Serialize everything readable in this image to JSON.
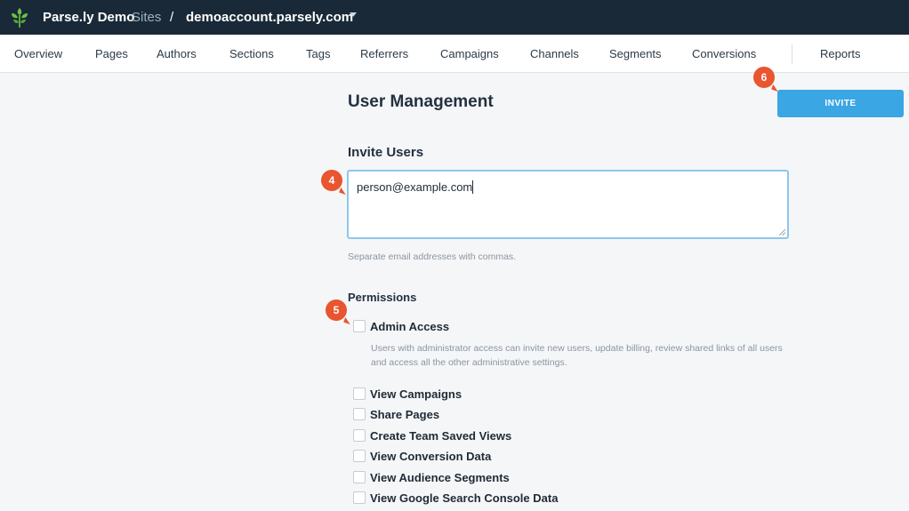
{
  "topbar": {
    "brand": "Parse.ly Demo",
    "sites_label": "Sites",
    "separator": "/",
    "domain": "demoaccount.parsely.com",
    "logo_icon": "parsely-leaf-icon",
    "brand_color": "#192938"
  },
  "nav": {
    "items": [
      {
        "label": "Overview"
      },
      {
        "label": "Pages"
      },
      {
        "label": "Authors"
      },
      {
        "label": "Sections"
      },
      {
        "label": "Tags"
      },
      {
        "label": "Referrers"
      },
      {
        "label": "Campaigns"
      },
      {
        "label": "Channels"
      },
      {
        "label": "Segments"
      },
      {
        "label": "Conversions"
      },
      {
        "label": "Reports"
      }
    ]
  },
  "main": {
    "title": "User Management",
    "invite_button": "INVITE",
    "invite_section_title": "Invite Users",
    "email_value": "person@example.com",
    "email_hint": "Separate email addresses with commas.",
    "permissions_title": "Permissions",
    "admin_label": "Admin Access",
    "admin_desc": "Users with administrator access can invite new users, update billing, review shared links of all users and access all the other administrative settings.",
    "permissions": [
      {
        "label": "View Campaigns",
        "checked": false
      },
      {
        "label": "Share Pages",
        "checked": false
      },
      {
        "label": "Create Team Saved Views",
        "checked": false
      },
      {
        "label": "View Conversion Data",
        "checked": false
      },
      {
        "label": "View Audience Segments",
        "checked": false
      },
      {
        "label": "View Google Search Console Data",
        "checked": false
      }
    ],
    "accent_color": "#3aa6e3"
  },
  "badges": {
    "invite": "6",
    "email": "4",
    "permissions": "5",
    "color": "#e8552f"
  }
}
